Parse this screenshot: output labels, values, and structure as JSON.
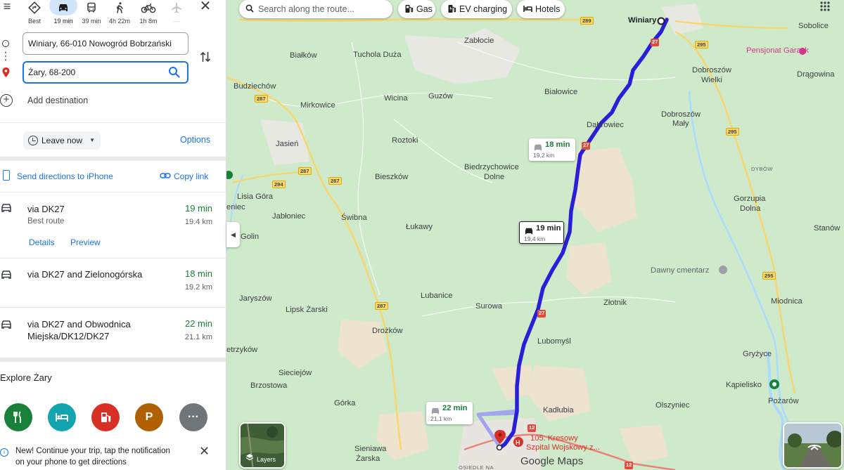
{
  "travel_modes": [
    {
      "label": "Best",
      "icon": "diamond-turn-icon"
    },
    {
      "label": "19 min",
      "icon": "car-icon"
    },
    {
      "label": "39 min",
      "icon": "bus-icon"
    },
    {
      "label": "4h 22m",
      "icon": "walk-icon"
    },
    {
      "label": "1h 8m",
      "icon": "bike-icon"
    },
    {
      "label": "—",
      "icon": "plane-icon"
    }
  ],
  "origin": "Winiary, 66-010 Nowogród Bobrzański",
  "destination": "Żary, 68-200",
  "add_destination": "Add destination",
  "leave_now": "Leave now",
  "options": "Options",
  "send_to_phone": "Send directions to iPhone",
  "copy_link": "Copy link",
  "routes": [
    {
      "name": "via DK27",
      "time": "19 min",
      "distance": "19.4 km",
      "note": "Best route",
      "details": "Details",
      "preview": "Preview"
    },
    {
      "name": "via DK27 and Zielonogórska",
      "time": "18 min",
      "distance": "19.2 km"
    },
    {
      "name_line1": "via DK27 and Obwodnica",
      "name_line2": "Miejska/DK12/DK27",
      "time": "22 min",
      "distance": "21.1 km"
    }
  ],
  "explore_title": "Explore Żary",
  "explore_categories": [
    {
      "icon": "restaurant-icon",
      "color": "#188038"
    },
    {
      "icon": "hotel-icon",
      "color": "#12a4af"
    },
    {
      "icon": "gas-station-icon",
      "color": "#d93025"
    },
    {
      "icon": "parking-icon",
      "color": "#b06000"
    },
    {
      "icon": "more-icon",
      "color": "#70757a"
    }
  ],
  "notification": {
    "line1": "New! Continue your trip, tap the notification",
    "line2": "on your phone to get directions"
  },
  "map": {
    "search_placeholder": "Search along the route...",
    "chips": [
      "Gas",
      "EV charging",
      "Hotels"
    ],
    "bubbles": [
      {
        "time": "18 min",
        "distance": "19,2 km"
      },
      {
        "time": "19 min",
        "distance": "19,4 km"
      },
      {
        "time": "22 min",
        "distance": "21,1 km"
      }
    ],
    "labels": {
      "winiary": "Winiary",
      "sobolice": "Sobolice",
      "zablocie": "Zabłocie",
      "bialkow": "Białków",
      "tuchola": "Tuchola Duża",
      "pensjonat": "Pensjonat Garack",
      "dragowina": "Drągowina",
      "dobroszow_w1": "Dobroszów",
      "dobroszow_w2": "Wielki",
      "budziechow": "Budziechów",
      "bialowice": "Białowice",
      "wicina": "Wicina",
      "guzow": "Guzów",
      "mirkowice": "Mirkowice",
      "dobroszow_m1": "Dobroszów",
      "dobroszow_m2": "Mały",
      "dabrowiec": "Dąbrowiec",
      "jasien": "Jasień",
      "roztoki": "Roztoki",
      "biedrzychowice1": "Biedrzychowice",
      "biedrzychowice2": "Dolne",
      "dybow": "DYBÓW",
      "bieszkow": "Bieszków",
      "lisia": "Lisia Góra",
      "eniec": "eniec",
      "gorzupia1": "Gorzupia",
      "gorzupia2": "Dolna",
      "jabloniec": "Jabłoniec",
      "swibna": "Świbna",
      "stanow": "Stanów",
      "lukawy": "Łukawy",
      "golin": "Golin",
      "cmentarz": "Dawny cmentarz",
      "jaryszow": "Jaryszów",
      "lubanice": "Lubanice",
      "miodnica": "Miodnica",
      "lipsk": "Lipsk Żarski",
      "surowa": "Surowa",
      "zlotnik": "Złotnik",
      "drozkow": "Drożków",
      "lubomysl": "Lubomyśl",
      "etrzykow": "etrzyków",
      "gryzyce": "Gryżyce",
      "siecie": "Sieciejów",
      "brzostowa": "Brzostowa",
      "kapielisko": "Kąpielisko",
      "gorka": "Górka",
      "kadlubia": "Kadłubia",
      "olszyniec": "Olszyniec",
      "pozarow": "Pożarów",
      "szpital1": "105. Kresowy",
      "szpital2": "Szpital Wojskowy z...",
      "sieniawa1": "Sieniawa",
      "sieniawa2": "Żarska",
      "osiedle": "OSIEDLE NA",
      "layers": "Layers",
      "google_maps": "Google Maps"
    },
    "roads": {
      "r289": "289",
      "r295": "295",
      "r287": "287",
      "r294": "294",
      "r27": "27",
      "r12": "12"
    },
    "colors": {
      "route": "#2a1fd6",
      "alt_route": "#a4a3f0",
      "water": "#aadaff",
      "forest": "#cfeacb",
      "field": "#ede3cf"
    }
  }
}
